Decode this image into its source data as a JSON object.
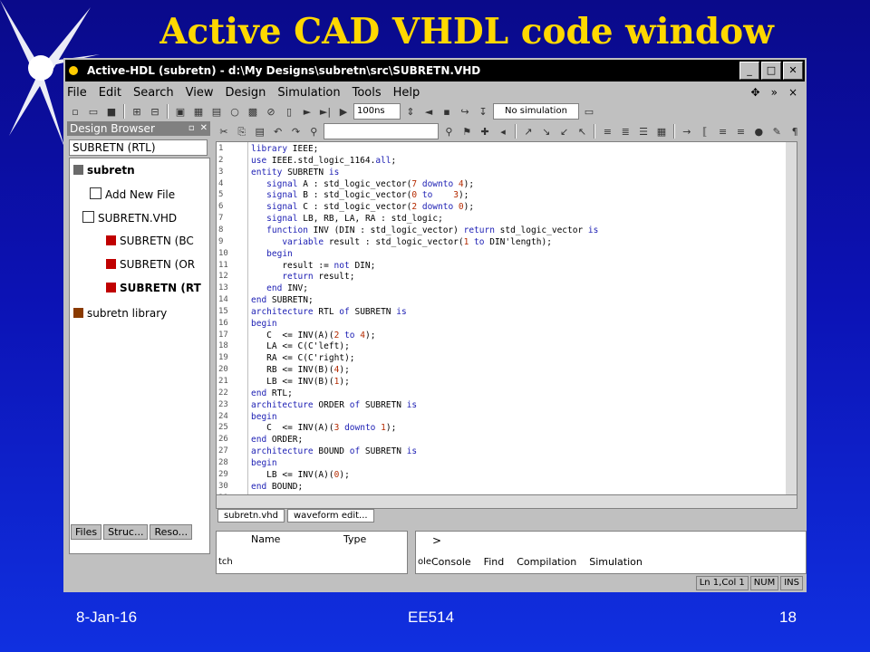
{
  "slide": {
    "title": "Active CAD VHDL code window",
    "footer_date": "8-Jan-16",
    "footer_course": "EE514",
    "footer_page": "18"
  },
  "window": {
    "title": "Active-HDL (subretn) - d:\\My Designs\\subretn\\src\\SUBRETN.VHD",
    "controls": [
      "_",
      "□",
      "✕"
    ]
  },
  "menu": {
    "items": [
      "File",
      "Edit",
      "Search",
      "View",
      "Design",
      "Simulation",
      "Tools",
      "Help"
    ],
    "right_symbols": [
      "✥",
      "»",
      "×"
    ]
  },
  "toolbar": {
    "sim_time": "100ns",
    "sim_status": "No simulation"
  },
  "design_browser": {
    "title": "Design Browser",
    "selector": "SUBRETN (RTL)",
    "tree": [
      "subretn",
      "Add New File",
      "SUBRETN.VHD",
      "SUBRETN (BC",
      "SUBRETN (OR",
      "SUBRETN (RT",
      "subretn library"
    ],
    "tabs": [
      "Files",
      "Struc...",
      "Reso..."
    ]
  },
  "editor": {
    "lines": [
      "library IEEE;",
      "use IEEE.std_logic_1164.all;",
      "entity SUBRETN is",
      "   signal A : std_logic_vector(7 downto 4);",
      "   signal B : std_logic_vector(0 to    3);",
      "   signal C : std_logic_vector(2 downto 0);",
      "   signal LB, RB, LA, RA : std_logic;",
      "   function INV (DIN : std_logic_vector) return std_logic_vector is",
      "      variable result : std_logic_vector(1 to DIN'length);",
      "   begin",
      "      result := not DIN;",
      "      return result;",
      "   end INV;",
      "end SUBRETN;",
      "architecture RTL of SUBRETN is",
      "begin",
      "   C  <= INV(A)(2 to 4);",
      "   LA <= C(C'left);",
      "   RA <= C(C'right);",
      "   RB <= INV(B)(4);",
      "   LB <= INV(B)(1);",
      "end RTL;",
      "architecture ORDER of SUBRETN is",
      "begin",
      "   C  <= INV(A)(3 downto 1);",
      "end ORDER;",
      "architecture BOUND of SUBRETN is",
      "begin",
      "   LB <= INV(A)(0);",
      "end BOUND;",
      ""
    ],
    "doc_tabs": [
      "subretn.vhd",
      "waveform edit..."
    ]
  },
  "watch_panel": {
    "columns": [
      "Name",
      "Type"
    ],
    "side_label": "tch"
  },
  "console_panel": {
    "prompt": ">",
    "side_label": "ole",
    "tabs": [
      "Console",
      "Find",
      "Compilation",
      "Simulation"
    ]
  },
  "status": {
    "position": "Ln 1,Col 1",
    "num": "NUM",
    "ins": "INS"
  }
}
